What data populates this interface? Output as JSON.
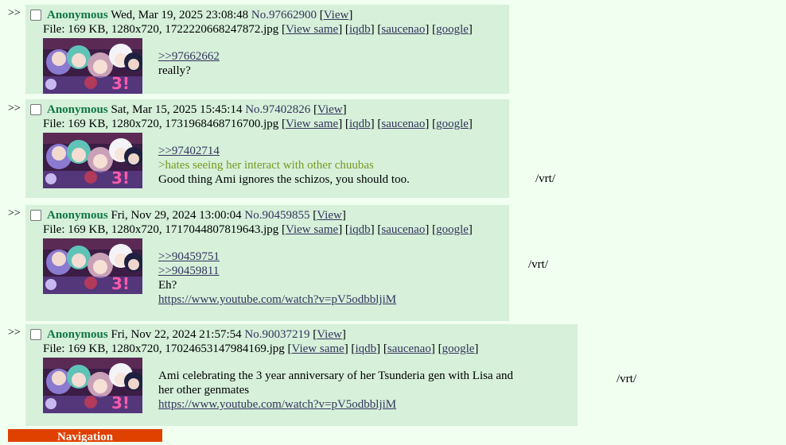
{
  "posts": [
    {
      "arrows": ">>",
      "name": "Anonymous",
      "datetime": "Wed, Mar 19, 2025 23:08:48",
      "postno": "No.97662900",
      "view": "View",
      "file_prefix": "File: 169 KB, 1280x720, 1722220668247872.jpg",
      "view_same": "View same",
      "iqdb": "iqdb",
      "saucenao": "saucenao",
      "google": "google",
      "quotelinks": [
        ">>97662662"
      ],
      "greentext": "",
      "text": "really?",
      "url": "",
      "board": ""
    },
    {
      "arrows": ">>",
      "name": "Anonymous",
      "datetime": "Sat, Mar 15, 2025 15:45:14",
      "postno": "No.97402826",
      "view": "View",
      "file_prefix": "File: 169 KB, 1280x720, 1731968468716700.jpg",
      "view_same": "View same",
      "iqdb": "iqdb",
      "saucenao": "saucenao",
      "google": "google",
      "quotelinks": [
        ">>97402714"
      ],
      "greentext": ">hates seeing her interact with other chuubas",
      "text": "Good thing Ami ignores the schizos, you should too.",
      "url": "",
      "board": "/vrt/"
    },
    {
      "arrows": ">>",
      "name": "Anonymous",
      "datetime": "Fri, Nov 29, 2024 13:00:04",
      "postno": "No.90459855",
      "view": "View",
      "file_prefix": "File: 169 KB, 1280x720, 1717044807819643.jpg",
      "view_same": "View same",
      "iqdb": "iqdb",
      "saucenao": "saucenao",
      "google": "google",
      "quotelinks": [
        ">>90459751",
        ">>90459811"
      ],
      "greentext": "",
      "text": "Eh?",
      "url": "https://www.youtube.com/watch?v=pV5odbbljiM",
      "board": "/vrt/"
    },
    {
      "arrows": ">>",
      "name": "Anonymous",
      "datetime": "Fri, Nov 22, 2024 21:57:54",
      "postno": "No.90037219",
      "view": "View",
      "file_prefix": "File: 169 KB, 1280x720, 17024653147984169.jpg",
      "view_same": "View same",
      "iqdb": "iqdb",
      "saucenao": "saucenao",
      "google": "google",
      "quotelinks": [],
      "greentext": "",
      "text_line1": "Ami celebrating the 3 year anniversary of her Tsunderia gen with Lisa and",
      "text_line2": "her other genmates",
      "url": "https://www.youtube.com/watch?v=pV5odbbljiM",
      "board": "/vrt/"
    }
  ],
  "navigation": "Navigation",
  "colors": {
    "background": "#f0fff0",
    "reply_bg": "#d6f0da",
    "name": "#117743",
    "link": "#34345c",
    "greentext": "#789922",
    "nav_bar": "#e04000"
  }
}
